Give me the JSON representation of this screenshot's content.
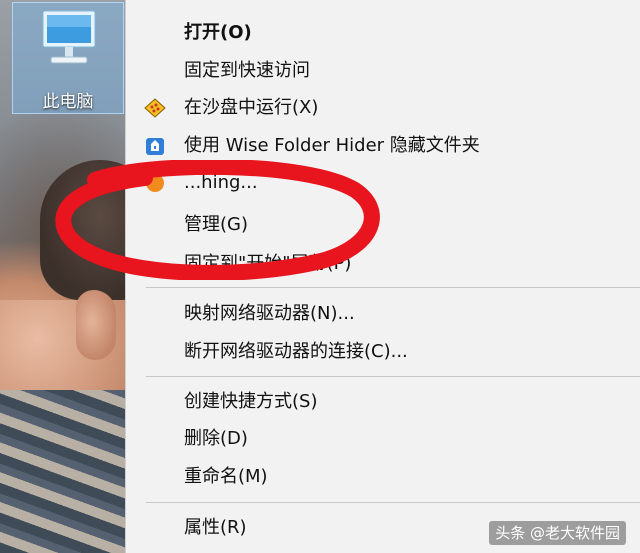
{
  "desktop": {
    "icon_label": "此电脑"
  },
  "menu": {
    "items": [
      {
        "label": "打开(O)",
        "icon": null,
        "bold": true
      },
      {
        "label": "固定到快速访问",
        "icon": null
      },
      {
        "label": "在沙盘中运行(X)",
        "icon": "sandbox-icon"
      },
      {
        "label": "使用 Wise Folder Hider 隐藏文件夹",
        "icon": "wise-folder-hider-icon"
      },
      {
        "label": "...hing...",
        "icon": "orange-app-icon"
      },
      {
        "label": "管理(G)",
        "icon": null
      },
      {
        "label": "固定到\"开始\"屏幕(P)",
        "icon": null
      },
      {
        "label": "映射网络驱动器(N)...",
        "icon": null
      },
      {
        "label": "断开网络驱动器的连接(C)...",
        "icon": null
      },
      {
        "label": "创建快捷方式(S)",
        "icon": null
      },
      {
        "label": "删除(D)",
        "icon": null
      },
      {
        "label": "重命名(M)",
        "icon": null
      },
      {
        "label": "属性(R)",
        "icon": null
      }
    ]
  },
  "annotation": {
    "color": "#e8141e"
  },
  "watermark": {
    "text": "头条 @老大软件园"
  }
}
